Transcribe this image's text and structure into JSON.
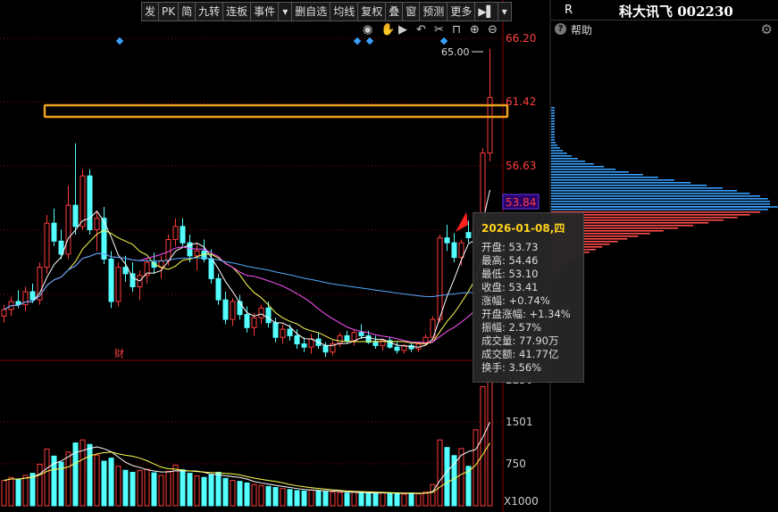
{
  "toolbar": {
    "items": [
      "发",
      "PK",
      "简",
      "九转",
      "连板",
      "事件",
      "▾",
      "删自选",
      "均线",
      "复权",
      "叠",
      "窗",
      "预测",
      "更多",
      "▶▌",
      "▾"
    ]
  },
  "header": {
    "left_label": "R",
    "stock_name": "科大讯飞",
    "stock_code": "002230",
    "help_label": "帮助"
  },
  "top_icons": [
    "eye-icon",
    "hand-icon",
    "play-icon",
    "undo-icon",
    "scissors-icon",
    "lock-icon",
    "zoom-in-icon",
    "zoom-out-icon"
  ],
  "price_axis": {
    "labels": [
      "66.20",
      "61.42",
      "56.63",
      "53.84"
    ],
    "current_price": "53.84",
    "peak_label": "65.00"
  },
  "volume_axis": {
    "labels": [
      "2250",
      "1501",
      "750"
    ],
    "unit": "X1000"
  },
  "event_marker": "财",
  "tooltip": {
    "date": "2026-01-08,四",
    "rows": [
      {
        "label": "开盘:",
        "value": "53.73"
      },
      {
        "label": "最高:",
        "value": "54.46"
      },
      {
        "label": "最低:",
        "value": "53.10"
      },
      {
        "label": "收盘:",
        "value": "53.41"
      },
      {
        "label": "涨幅:",
        "value": "+0.74%"
      },
      {
        "label": "开盘涨幅:",
        "value": "+1.34%"
      },
      {
        "label": "振幅:",
        "value": "2.57%"
      },
      {
        "label": "成交量:",
        "value": "77.90万"
      },
      {
        "label": "成交额:",
        "value": "41.77亿"
      },
      {
        "label": "换手:",
        "value": "3.56%"
      }
    ]
  },
  "colors": {
    "up": "#ff3b3b",
    "down": "#54ffff",
    "highlight_box": "#f0a020",
    "ma5": "#ffffff",
    "ma10": "#ffff55",
    "ma20": "#ff55ff",
    "ma60": "#55aaff",
    "grid": "#8b0000",
    "price_label": "#ff4040"
  },
  "chart_data": {
    "type": "candlestick",
    "price_range": [
      46.0,
      67.0
    ],
    "candles": [
      [
        48.6,
        49.3,
        48.2,
        49.0
      ],
      [
        49.0,
        49.8,
        48.6,
        49.5
      ],
      [
        49.5,
        50.2,
        49.1,
        49.3
      ],
      [
        49.3,
        50.4,
        48.9,
        50.1
      ],
      [
        50.1,
        50.6,
        49.4,
        49.6
      ],
      [
        49.6,
        51.9,
        49.3,
        51.6
      ],
      [
        51.6,
        54.8,
        51.2,
        54.3
      ],
      [
        54.3,
        55.2,
        52.9,
        53.2
      ],
      [
        53.2,
        53.9,
        52.1,
        52.4
      ],
      [
        52.4,
        56.6,
        52.1,
        55.4
      ],
      [
        55.4,
        59.2,
        53.6,
        54.1
      ],
      [
        54.1,
        57.6,
        53.9,
        57.2
      ],
      [
        57.2,
        57.6,
        53.6,
        53.9
      ],
      [
        53.9,
        55.0,
        52.6,
        54.6
      ],
      [
        54.6,
        55.3,
        51.8,
        52.1
      ],
      [
        52.1,
        52.6,
        49.1,
        49.5
      ],
      [
        49.5,
        51.9,
        49.2,
        51.6
      ],
      [
        51.6,
        52.3,
        50.7,
        51.2
      ],
      [
        51.2,
        51.9,
        50.1,
        50.4
      ],
      [
        50.4,
        51.4,
        49.6,
        51.1
      ],
      [
        51.1,
        52.1,
        50.6,
        51.9
      ],
      [
        51.9,
        52.5,
        51.2,
        51.6
      ],
      [
        51.6,
        52.3,
        50.9,
        52.0
      ],
      [
        52.0,
        53.6,
        51.7,
        53.3
      ],
      [
        53.3,
        54.6,
        52.9,
        54.1
      ],
      [
        54.1,
        54.6,
        52.9,
        53.1
      ],
      [
        53.1,
        53.6,
        51.9,
        52.3
      ],
      [
        52.3,
        53.1,
        51.4,
        52.6
      ],
      [
        52.6,
        53.3,
        51.9,
        52.1
      ],
      [
        52.1,
        52.7,
        50.6,
        50.9
      ],
      [
        50.9,
        51.2,
        49.3,
        49.6
      ],
      [
        49.6,
        50.1,
        48.1,
        48.4
      ],
      [
        48.4,
        49.7,
        48.0,
        49.5
      ],
      [
        49.5,
        49.9,
        48.4,
        48.7
      ],
      [
        48.7,
        49.2,
        47.6,
        47.9
      ],
      [
        47.9,
        48.8,
        47.4,
        48.5
      ],
      [
        48.5,
        49.3,
        48.1,
        49.1
      ],
      [
        49.1,
        49.5,
        47.9,
        48.2
      ],
      [
        48.2,
        48.5,
        47.0,
        47.3
      ],
      [
        47.3,
        48.1,
        46.9,
        47.8
      ],
      [
        47.8,
        48.1,
        47.1,
        47.4
      ],
      [
        47.4,
        47.8,
        46.6,
        46.9
      ],
      [
        46.9,
        47.3,
        46.4,
        46.7
      ],
      [
        46.7,
        47.5,
        46.3,
        47.2
      ],
      [
        47.2,
        47.6,
        46.6,
        46.8
      ],
      [
        46.8,
        47.0,
        46.1,
        46.4
      ],
      [
        46.4,
        47.1,
        46.2,
        46.9
      ],
      [
        46.9,
        47.6,
        46.7,
        47.4
      ],
      [
        47.4,
        47.7,
        46.9,
        47.1
      ],
      [
        47.1,
        47.8,
        46.8,
        47.6
      ],
      [
        47.6,
        48.1,
        47.2,
        47.4
      ],
      [
        47.4,
        47.7,
        46.9,
        47.0
      ],
      [
        47.0,
        47.4,
        46.6,
        46.8
      ],
      [
        46.8,
        47.2,
        46.5,
        47.1
      ],
      [
        47.1,
        47.3,
        46.6,
        46.7
      ],
      [
        46.7,
        47.0,
        46.3,
        46.5
      ],
      [
        46.5,
        46.9,
        46.3,
        46.8
      ],
      [
        46.8,
        47.0,
        46.4,
        46.6
      ],
      [
        46.6,
        47.0,
        46.4,
        46.9
      ],
      [
        46.9,
        47.5,
        46.8,
        47.3
      ],
      [
        47.3,
        48.6,
        47.1,
        48.4
      ],
      [
        48.4,
        53.6,
        48.2,
        53.4
      ],
      [
        53.4,
        54.2,
        52.6,
        53.1
      ],
      [
        53.1,
        53.7,
        51.9,
        52.2
      ],
      [
        52.2,
        53.3,
        51.7,
        53.1
      ],
      [
        53.73,
        54.46,
        53.1,
        53.41
      ],
      [
        53.4,
        55.0,
        53.0,
        54.6
      ],
      [
        54.6,
        58.9,
        54.4,
        58.6
      ],
      [
        58.6,
        65.0,
        58.1,
        62.0
      ]
    ],
    "volumes": [
      500,
      560,
      520,
      600,
      640,
      820,
      1120,
      980,
      860,
      1060,
      1240,
      1300,
      1210,
      1000,
      880,
      940,
      780,
      700,
      660,
      700,
      720,
      650,
      600,
      680,
      800,
      710,
      640,
      590,
      560,
      610,
      660,
      540,
      500,
      480,
      450,
      420,
      400,
      380,
      360,
      340,
      320,
      300,
      290,
      310,
      300,
      280,
      270,
      260,
      250,
      270,
      260,
      250,
      240,
      260,
      250,
      240,
      230,
      250,
      240,
      270,
      420,
      1300,
      1150,
      990,
      1130,
      779,
      1500,
      2350,
      2500
    ]
  }
}
